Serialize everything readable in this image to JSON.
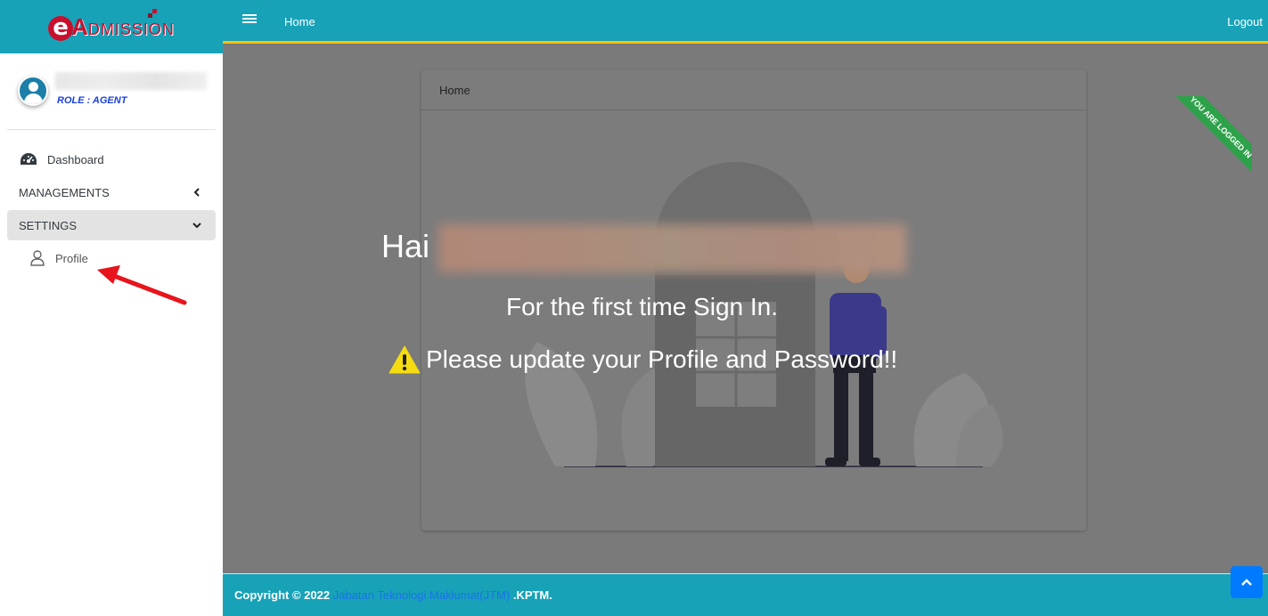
{
  "brand": {
    "logo_text": "eADMISSION"
  },
  "user": {
    "role": "ROLE : AGENT"
  },
  "sidebar": {
    "items": [
      {
        "label": "Dashboard",
        "icon": "tachometer-icon"
      },
      {
        "label": "MANAGEMENTS",
        "icon": "chevron-left-icon"
      },
      {
        "label": "SETTINGS",
        "icon": "chevron-down-icon"
      }
    ],
    "sub_items": [
      {
        "label": "Profile",
        "icon": "user-icon"
      }
    ]
  },
  "topbar": {
    "home": "Home",
    "logout": "Logout"
  },
  "card": {
    "header": "Home",
    "ribbon": "YOU ARE LOGGED IN",
    "greeting": "Hai",
    "line1": "For the first time Sign In.",
    "line2": "Please update your Profile and Password!!"
  },
  "footer": {
    "copyright": "Copyright © 2022",
    "link": "Jabatan Teknologi Maklumat(JTM)",
    "suffix": ".KPTM."
  },
  "colors": {
    "primary": "#17a2b8",
    "accent_border": "#ffc107",
    "brand_red": "#c8102e",
    "ribbon_green": "#2ea24a",
    "role_blue": "#1a3fe0",
    "scroll_btn": "#007bff"
  }
}
